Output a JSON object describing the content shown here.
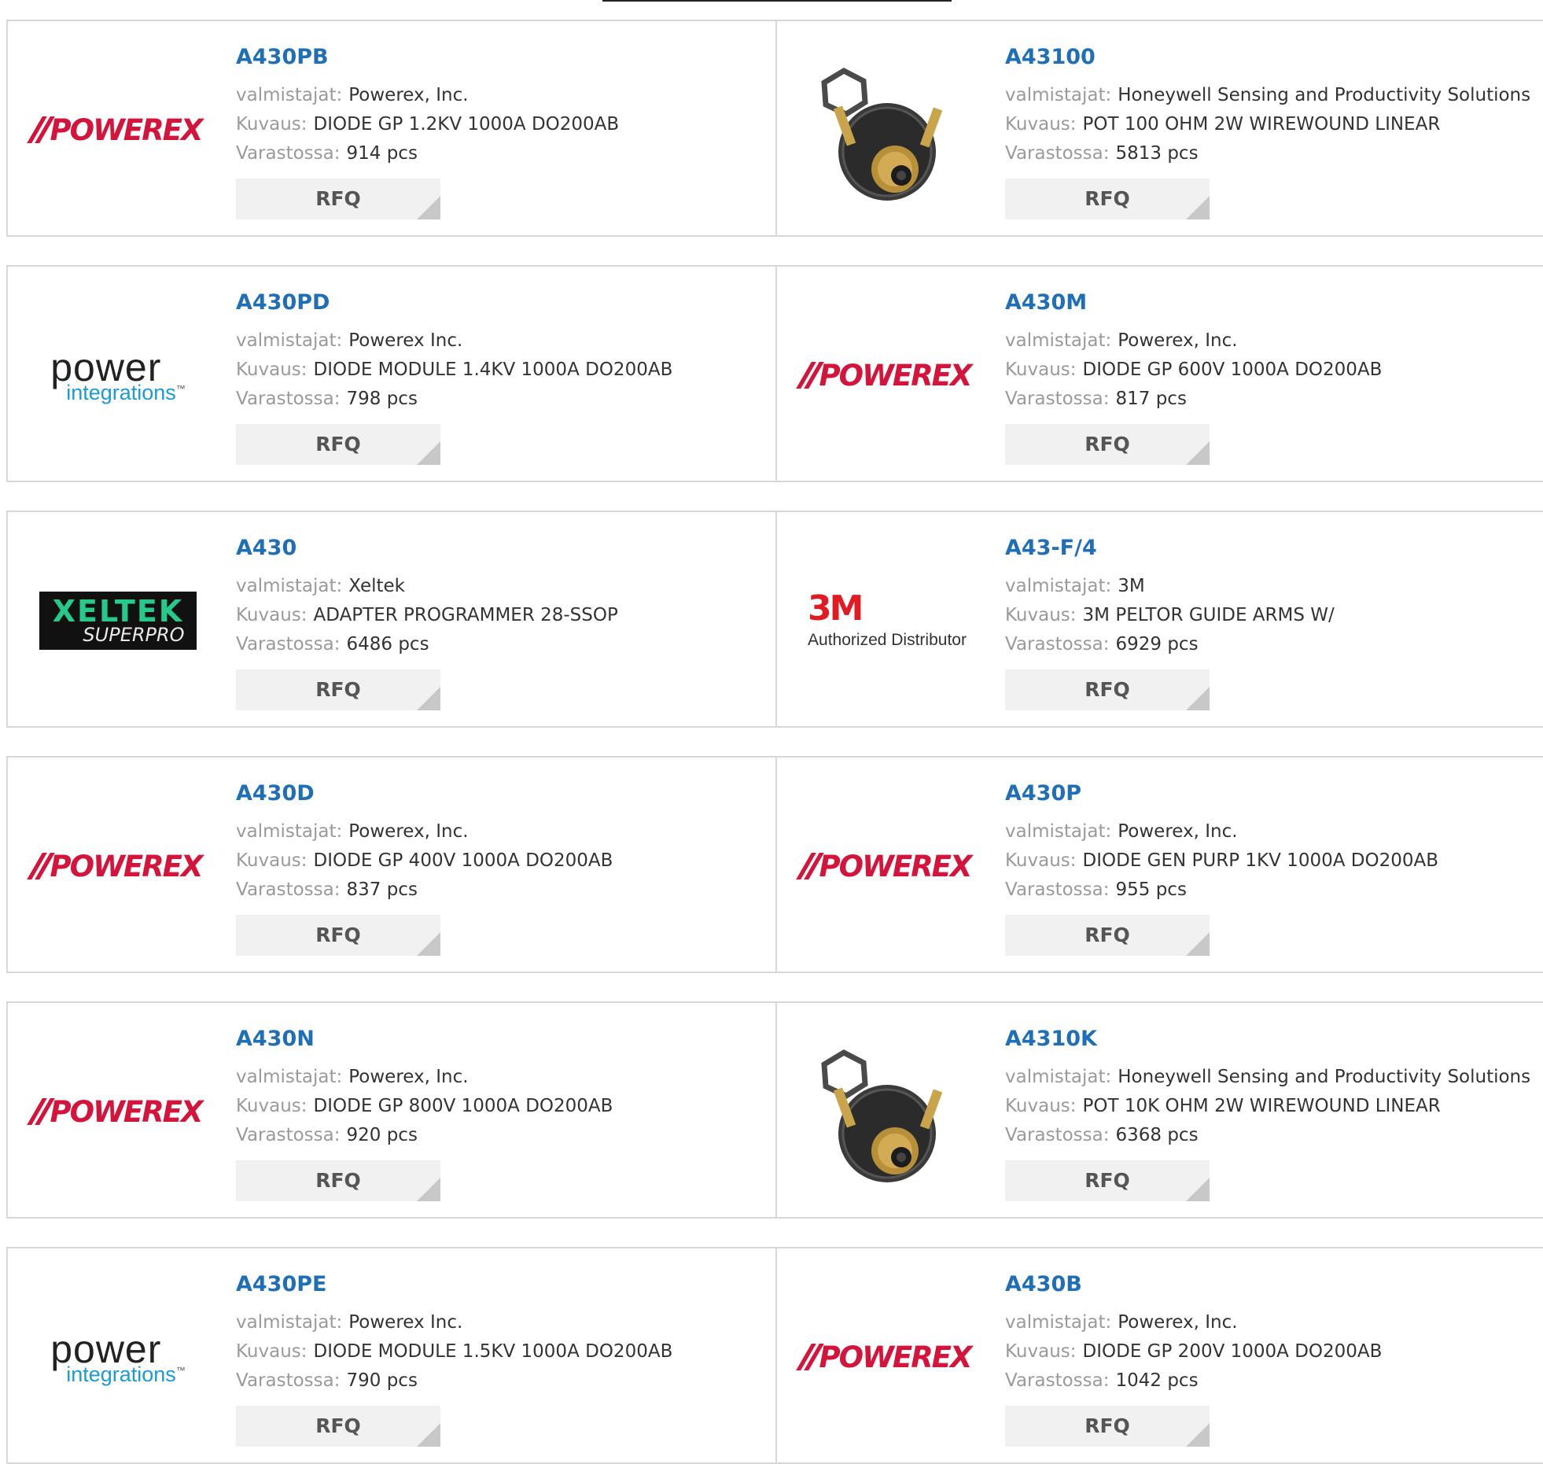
{
  "labels": {
    "manufacturer": "valmistajat:",
    "description": "Kuvaus:",
    "stock": "Varastossa:",
    "rfq": "RFQ"
  },
  "logos": {
    "powerex": "POWEREX",
    "power_integrations_top": "power",
    "power_integrations_bottom": "integrations",
    "power_integrations_tm": "™",
    "xeltek_top": "XELTEK",
    "xeltek_bottom": "SUPERPRO",
    "mmm_mark": "3M",
    "mmm_sub": "Authorized Distributor"
  },
  "products": [
    {
      "part": "A430PB",
      "manufacturer": "Powerex, Inc.",
      "description": "DIODE GP 1.2KV 1000A DO200AB",
      "stock": "914 pcs",
      "logo": "powerex"
    },
    {
      "part": "A43100",
      "manufacturer": "Honeywell Sensing and Productivity Solutions",
      "description": "POT 100 OHM 2W WIREWOUND LINEAR",
      "stock": "5813 pcs",
      "logo": "potentiometer-photo"
    },
    {
      "part": "A430PD",
      "manufacturer": "Powerex Inc.",
      "description": "DIODE MODULE 1.4KV 1000A DO200AB",
      "stock": "798 pcs",
      "logo": "power-integrations"
    },
    {
      "part": "A430M",
      "manufacturer": "Powerex, Inc.",
      "description": "DIODE GP 600V 1000A DO200AB",
      "stock": "817 pcs",
      "logo": "powerex"
    },
    {
      "part": "A430",
      "manufacturer": "Xeltek",
      "description": "ADAPTER PROGRAMMER 28-SSOP",
      "stock": "6486 pcs",
      "logo": "xeltek"
    },
    {
      "part": "A43-F/4",
      "manufacturer": "3M",
      "description": "3M PELTOR GUIDE ARMS W/",
      "stock": "6929 pcs",
      "logo": "3m"
    },
    {
      "part": "A430D",
      "manufacturer": "Powerex, Inc.",
      "description": "DIODE GP 400V 1000A DO200AB",
      "stock": "837 pcs",
      "logo": "powerex"
    },
    {
      "part": "A430P",
      "manufacturer": "Powerex, Inc.",
      "description": "DIODE GEN PURP 1KV 1000A DO200AB",
      "stock": "955 pcs",
      "logo": "powerex"
    },
    {
      "part": "A430N",
      "manufacturer": "Powerex, Inc.",
      "description": "DIODE GP 800V 1000A DO200AB",
      "stock": "920 pcs",
      "logo": "powerex"
    },
    {
      "part": "A4310K",
      "manufacturer": "Honeywell Sensing and Productivity Solutions",
      "description": "POT 10K OHM 2W WIREWOUND LINEAR",
      "stock": "6368 pcs",
      "logo": "potentiometer-photo"
    },
    {
      "part": "A430PE",
      "manufacturer": "Powerex Inc.",
      "description": "DIODE MODULE 1.5KV 1000A DO200AB",
      "stock": "790 pcs",
      "logo": "power-integrations"
    },
    {
      "part": "A430B",
      "manufacturer": "Powerex, Inc.",
      "description": "DIODE GP 200V 1000A DO200AB",
      "stock": "1042 pcs",
      "logo": "powerex"
    }
  ]
}
